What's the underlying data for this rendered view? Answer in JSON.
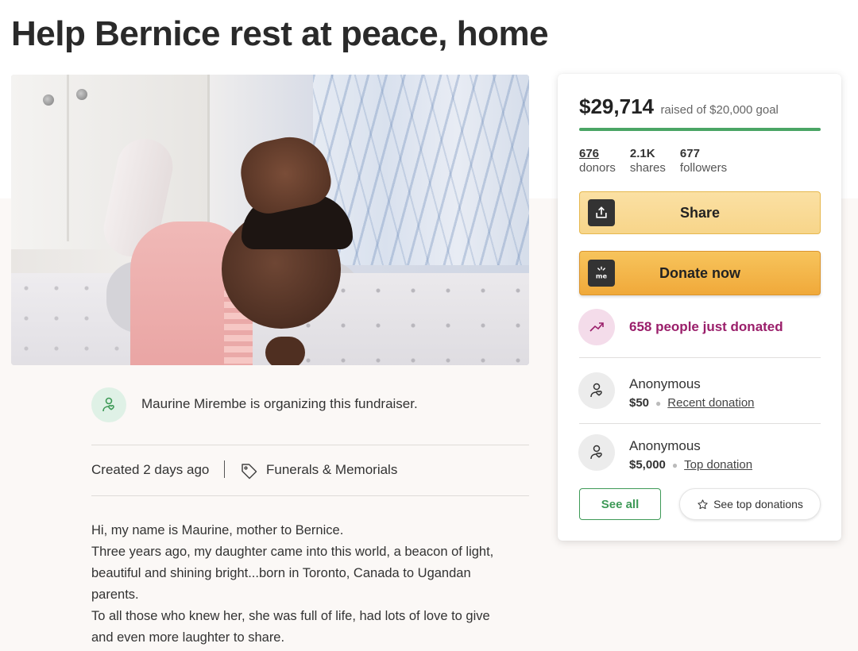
{
  "page": {
    "title": "Help Bernice rest at peace, home"
  },
  "organizer": {
    "text": "Maurine Mirembe is organizing this fundraiser."
  },
  "meta": {
    "created": "Created 2 days ago",
    "category": "Funerals & Memorials"
  },
  "story": {
    "lines": [
      "Hi, my name is Maurine,  mother to Bernice.",
      "Three years ago,  my daughter came into this world, a beacon of light,",
      "beautiful and shining bright...born in Toronto, Canada to Ugandan",
      "parents.",
      "To all those who knew her, she was full of life, had lots of love to give",
      "and even more laughter to share."
    ]
  },
  "donation": {
    "raised": "$29,714",
    "goal_text": "raised of $20,000 goal",
    "progress_fraction": 1.0,
    "stats": [
      {
        "num": "676",
        "label": "donors"
      },
      {
        "num": "2.1K",
        "label": "shares"
      },
      {
        "num": "677",
        "label": "followers"
      }
    ],
    "share_label": "Share",
    "donate_label": "Donate now",
    "trend_text": "658 people just donated",
    "donors": [
      {
        "name": "Anonymous",
        "amount": "$50",
        "kind": "Recent donation"
      },
      {
        "name": "Anonymous",
        "amount": "$5,000",
        "kind": "Top donation"
      }
    ],
    "see_all_label": "See all",
    "see_top_label": "See top donations"
  },
  "colors": {
    "accent_green": "#3e9a57",
    "donate_orange": "#f0a93a",
    "share_yellow": "#f7d58a",
    "trend_purple": "#9a1e6a"
  },
  "icons": {
    "share": "upload-icon",
    "donate": "gofundme-logo-icon",
    "trend": "trending-up-icon",
    "organizer": "heart-user-icon",
    "category": "tag-icon",
    "donor": "heart-user-icon",
    "see_top": "star-icon"
  }
}
